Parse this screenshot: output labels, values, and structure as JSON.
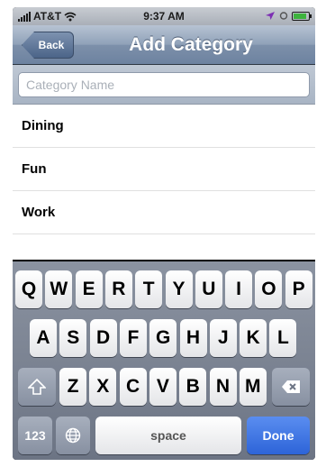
{
  "status_bar": {
    "carrier": "AT&T",
    "time": "9:37 AM",
    "battery_level": 0.9,
    "icons": [
      "signal-icon",
      "wifi-icon",
      "location-icon",
      "lock-icon",
      "battery-icon"
    ]
  },
  "nav": {
    "back_label": "Back",
    "title": "Add Category"
  },
  "input": {
    "placeholder": "Category Name",
    "value": ""
  },
  "categories": [
    {
      "label": "Dining"
    },
    {
      "label": "Fun"
    },
    {
      "label": "Work"
    }
  ],
  "keyboard": {
    "row1": [
      "Q",
      "W",
      "E",
      "R",
      "T",
      "Y",
      "U",
      "I",
      "O",
      "P"
    ],
    "row2": [
      "A",
      "S",
      "D",
      "F",
      "G",
      "H",
      "J",
      "K",
      "L"
    ],
    "row3": [
      "Z",
      "X",
      "C",
      "V",
      "B",
      "N",
      "M"
    ],
    "numbers_label": "123",
    "space_label": "space",
    "done_label": "Done"
  },
  "colors": {
    "nav_bar": "#7d90aa",
    "done_key": "#2d64d8",
    "keyboard_bg": "#6c7484"
  }
}
